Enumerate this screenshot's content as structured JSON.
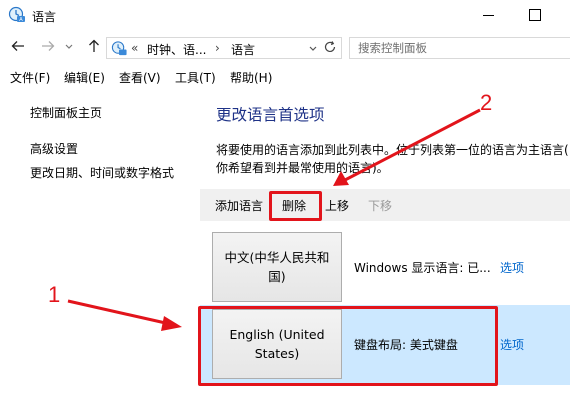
{
  "window": {
    "title": "语言",
    "icon": "clock-globe-icon"
  },
  "addressbar": {
    "overflow": "«",
    "crumbs": [
      "时钟、语...",
      "语言"
    ],
    "separator": "›",
    "search_placeholder": "搜索控制面板"
  },
  "menu": [
    "文件(F)",
    "编辑(E)",
    "查看(V)",
    "工具(T)",
    "帮助(H)"
  ],
  "sidebar": {
    "home": "控制面板主页",
    "links": [
      "高级设置",
      "更改日期、时间或数字格式"
    ]
  },
  "main": {
    "title": "更改语言首选项",
    "description_line1": "将要使用的语言添加到此列表中。位于列表第一位的语言为主语言(",
    "description_line2": "你希望看到并最常使用的语言)。"
  },
  "toolbar": {
    "add": "添加语言",
    "remove": "删除",
    "up": "上移",
    "down": "下移"
  },
  "languages": [
    {
      "name": "中文(中华人民共和国)",
      "status": "Windows 显示语言: 已...",
      "options": "选项",
      "selected": false
    },
    {
      "name": "English (United States)",
      "status": "键盘布局: 美式键盘",
      "options": "选项",
      "selected": true
    }
  ],
  "annotations": {
    "label1": "1",
    "label2": "2",
    "color": "#e2141b"
  },
  "colors": {
    "title_blue": "#1e3287",
    "link_blue": "#0066cc",
    "selection": "#cce8ff"
  }
}
